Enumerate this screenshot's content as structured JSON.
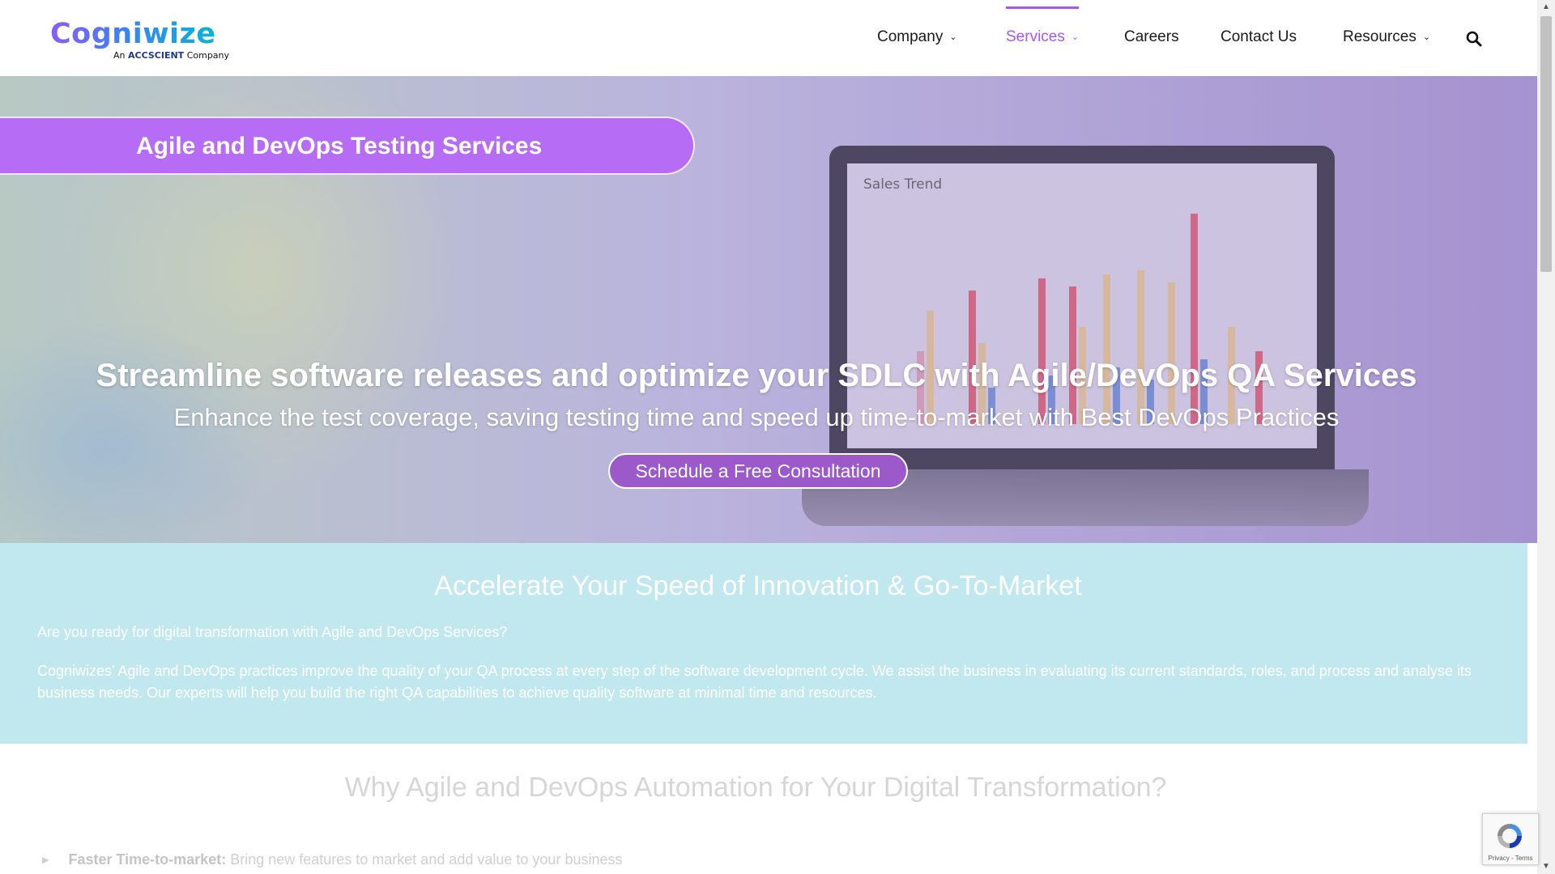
{
  "header": {
    "logo": {
      "name": "Cogniwize",
      "tagline_prefix": "An",
      "tagline_brand": "ACCSCIENT",
      "tagline_suffix": "Company"
    },
    "nav": [
      {
        "label": "Company",
        "has_dropdown": true,
        "active": false
      },
      {
        "label": "Services",
        "has_dropdown": true,
        "active": true
      },
      {
        "label": "Careers",
        "has_dropdown": false,
        "active": false
      },
      {
        "label": "Contact Us",
        "has_dropdown": false,
        "active": false
      },
      {
        "label": "Resources",
        "has_dropdown": true,
        "active": false
      }
    ],
    "search_icon": "search-icon"
  },
  "hero": {
    "badge": "Agile and DevOps Testing Services",
    "heading": "Streamline software releases and optimize your SDLC with Agile/DevOps QA Services",
    "subheading": "Enhance the test coverage, saving testing time and speed up time-to-market with Best DevOps Practices",
    "cta": "Schedule a Free Consultation",
    "screen_title": "Sales Trend"
  },
  "info": {
    "title": "Accelerate Your Speed of Innovation & Go-To-Market",
    "question": "Are you ready for digital transformation with Agile and DevOps Services?",
    "body": "Cogniwizes’ Agile and DevOps practices improve the quality of your QA process at every step of the software development cycle. We assist the business in evaluating its current standards, roles, and process and analyse its business needs. Our experts will help you build the right QA capabilities to achieve quality software at minimal time and resources."
  },
  "why": {
    "title": "Why Agile and DevOps Automation for Your Digital Transformation?",
    "items": [
      {
        "bold": "Faster Time-to-market:",
        "text": " Bring new features to market and add value to your business"
      }
    ]
  },
  "recaptcha": {
    "links": "Privacy - Terms"
  },
  "colors": {
    "accent": "#a855f7",
    "badge": "#b66cf5",
    "info_bg": "#c1e8ef",
    "cta_bg": "#9b59c9"
  }
}
